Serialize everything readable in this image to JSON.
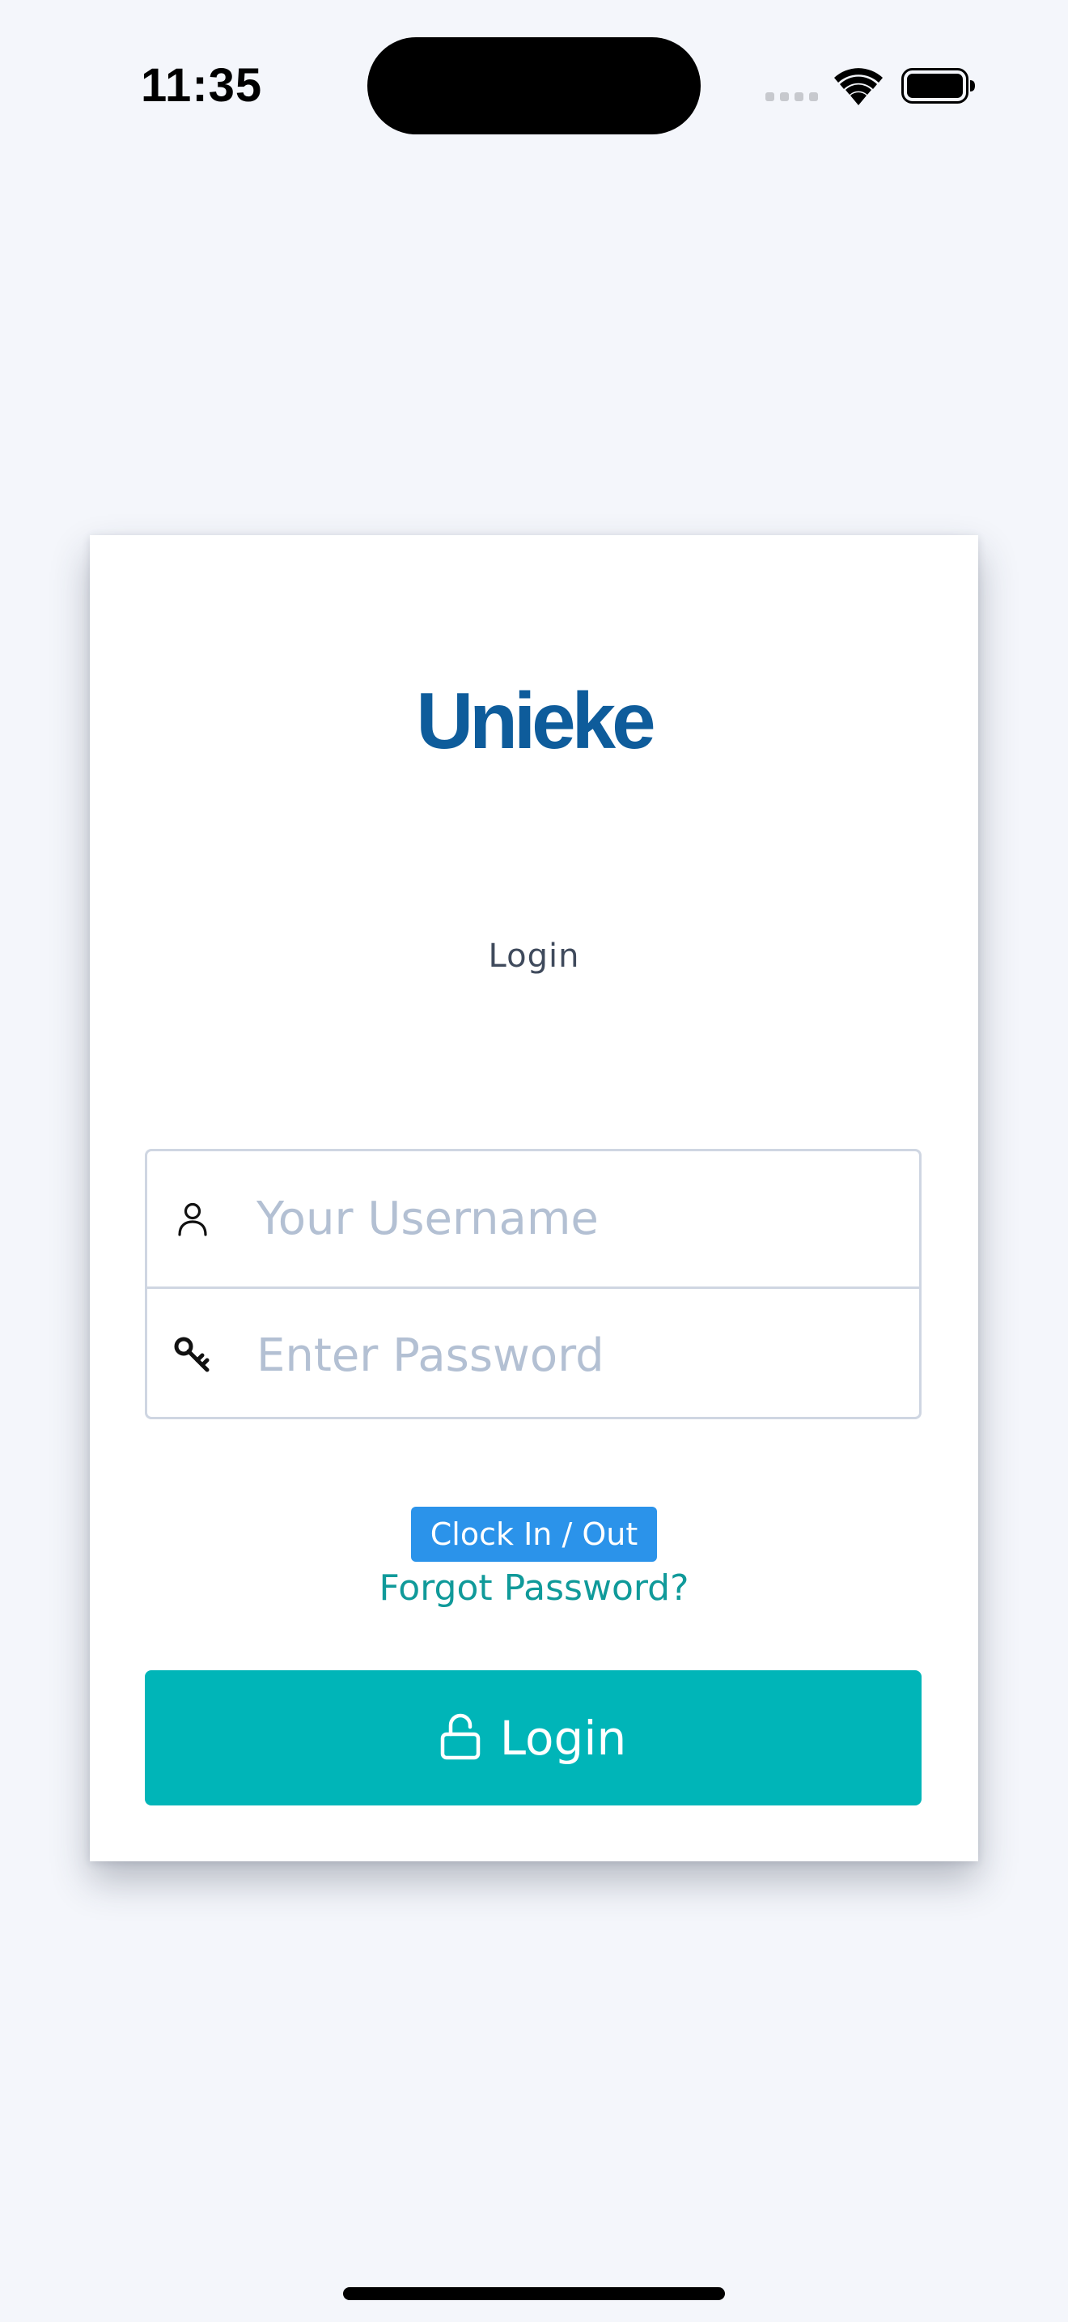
{
  "status_bar": {
    "time": "11:35"
  },
  "card": {
    "logo_text": "Unieke",
    "heading": "Login",
    "username_field": {
      "placeholder": "Your Username",
      "value": "",
      "icon": "user-icon"
    },
    "password_field": {
      "placeholder": "Enter Password",
      "value": "",
      "icon": "key-icon"
    },
    "clock_button_label": "Clock In / Out",
    "forgot_password_label": "Forgot Password?",
    "login_button": {
      "label": "Login",
      "icon": "unlock-icon"
    }
  },
  "colors": {
    "background": "#f4f6fb",
    "brand": "#0e5c9b",
    "clock_button": "#2b93ea",
    "link": "#109a9a",
    "primary_button": "#00b5b8",
    "placeholder": "#b3c0d3"
  }
}
